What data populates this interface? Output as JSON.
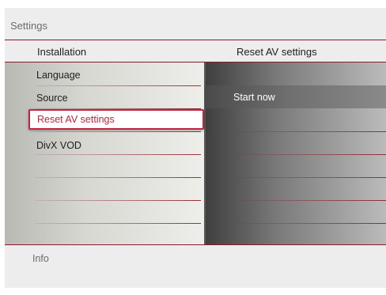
{
  "title": "Settings",
  "header": {
    "left": "Installation",
    "right": "Reset AV settings"
  },
  "menu": {
    "items": [
      "Language",
      "Source",
      "Reset AV settings",
      "DivX VOD"
    ],
    "selected": "Reset AV settings"
  },
  "submenu": {
    "items": [
      "Start now"
    ],
    "highlighted": "Start now"
  },
  "footer": {
    "info": "Info"
  },
  "colors": {
    "accent": "#c2253d",
    "divider": "#8a1a2a"
  }
}
